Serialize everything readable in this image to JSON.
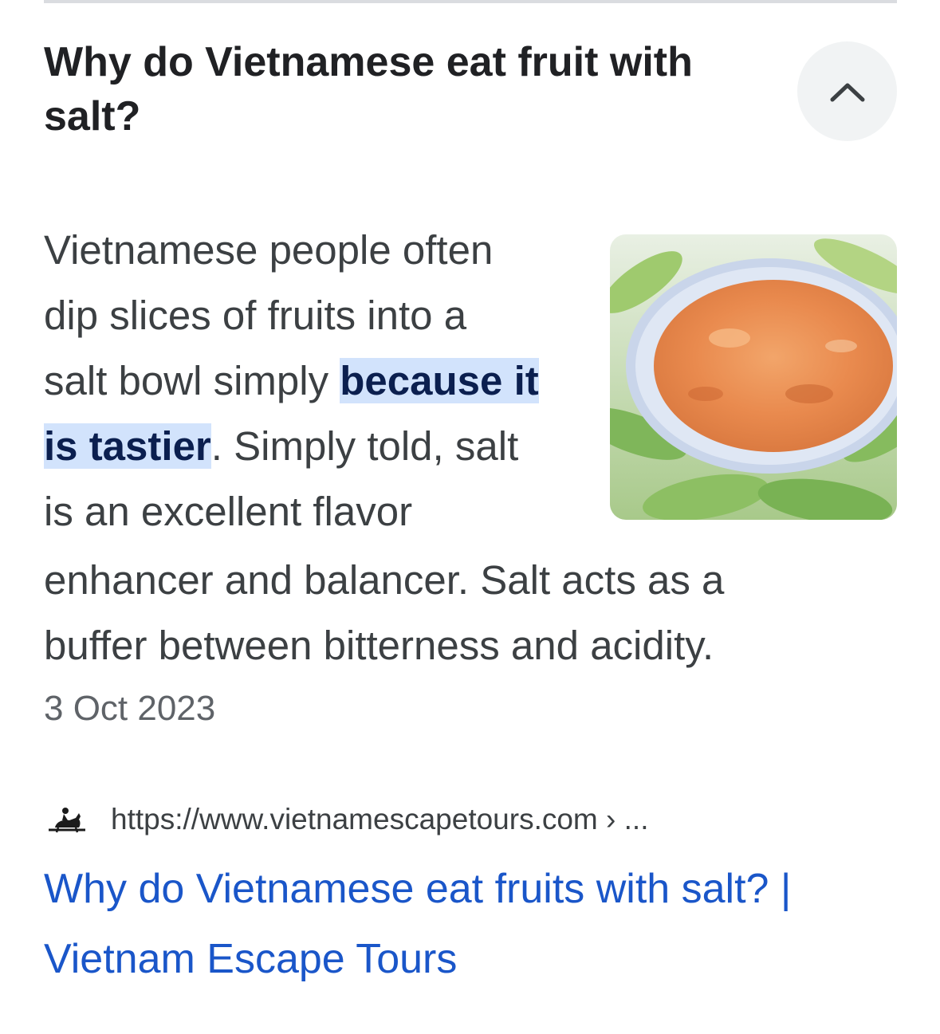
{
  "question": {
    "title": "Why do Vietnamese eat fruit with salt?",
    "collapse_icon": "chevron-up-icon"
  },
  "snippet": {
    "line1": "Vietnamese people often",
    "line2": "dip slices of fruits into a",
    "line3_before": "salt bowl simply ",
    "highlight_part1": "because it",
    "highlight_part2": "is tastier",
    "line4_after": ". Simply told, salt",
    "line5": "is an excellent flavor",
    "line6": "enhancer and balancer. Salt acts as a",
    "line7": "buffer between bitterness and acidity.",
    "date": "3 Oct 2023",
    "image_icon": "salt-bowl-thumbnail"
  },
  "source": {
    "favicon": "horse-rider-icon",
    "url": "https://www.vietnamescapetours.com › ..."
  },
  "result": {
    "title_line1": "Why do Vietnamese eat fruits with salt? |",
    "title_line2": "Vietnam Escape Tours"
  },
  "colors": {
    "link": "#1a56c9",
    "highlight_bg": "#d2e3fc",
    "button_bg": "#f1f3f4",
    "body_text": "#3c4043"
  }
}
